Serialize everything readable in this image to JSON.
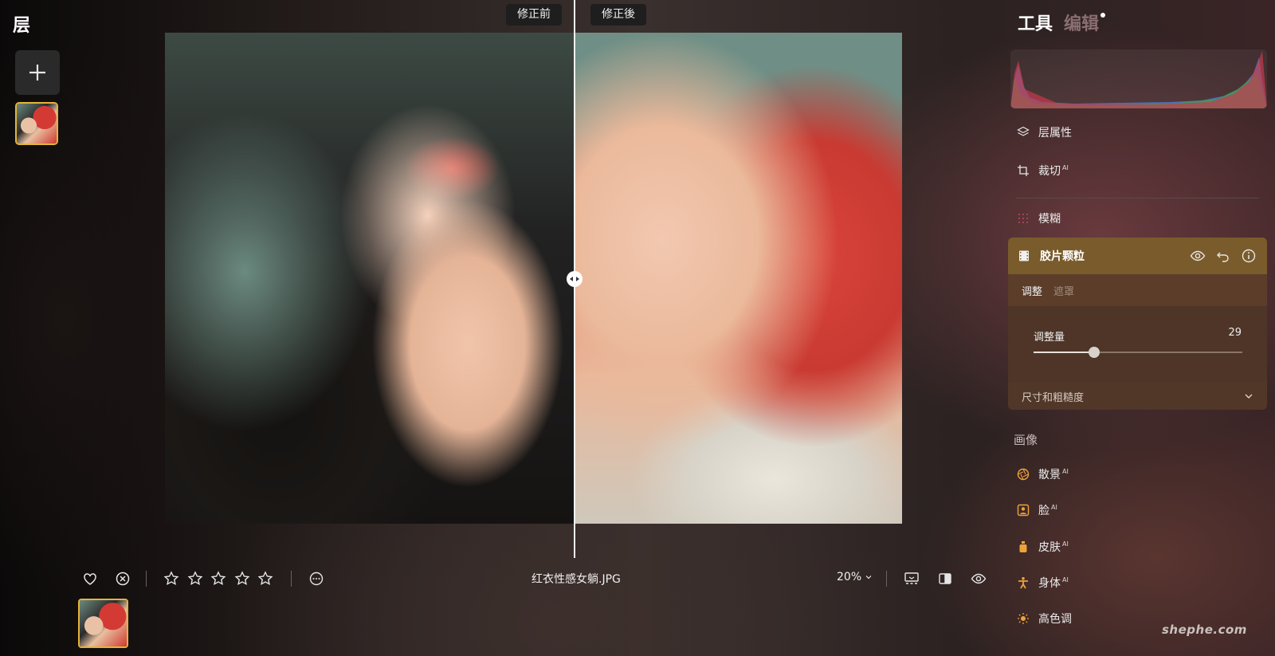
{
  "left_panel": {
    "title": "层",
    "add_icon": "plus-icon"
  },
  "canvas": {
    "before_label": "修正前",
    "after_label": "修正後",
    "compare_handle_icon": "split-arrows-icon"
  },
  "toolbar": {
    "filename": "红衣性感女躺.JPG",
    "zoom": "20%",
    "rating_stars": 5,
    "icons": [
      "heart-icon",
      "reject-icon",
      "star-icon",
      "more-icon",
      "chevron-down-icon",
      "monitor-icon",
      "compare-icon",
      "eye-icon"
    ]
  },
  "right_panel": {
    "tabs": {
      "tools": "工具",
      "edit": "编辑"
    },
    "tools": [
      {
        "label": "层属性",
        "icon": "layers-icon",
        "ai": ""
      },
      {
        "label": "裁切",
        "icon": "crop-icon",
        "ai": "AI"
      },
      {
        "label": "模糊",
        "icon": "blur-icon",
        "ai": ""
      }
    ],
    "active_tool": {
      "title": "胶片颗粒",
      "icon": "film-icon",
      "subtabs": {
        "adjust": "调整",
        "mask": "遮罩"
      },
      "slider": {
        "label": "调整量",
        "value": "29",
        "fraction": 0.29
      },
      "collapsible": "尺寸和粗糙度"
    },
    "portrait_section": {
      "title": "画像",
      "items": [
        {
          "label": "散景",
          "ai": "AI",
          "icon": "aperture-icon"
        },
        {
          "label": "脸",
          "ai": "AI",
          "icon": "face-icon"
        },
        {
          "label": "皮肤",
          "ai": "AI",
          "icon": "skin-icon"
        },
        {
          "label": "身体",
          "ai": "AI",
          "icon": "body-icon"
        },
        {
          "label": "高色调",
          "ai": "",
          "icon": "high-key-icon"
        }
      ]
    }
  },
  "watermark": "shephe.com",
  "colors": {
    "accent": "#e2b53a",
    "active_header": "#7a5b2c"
  }
}
